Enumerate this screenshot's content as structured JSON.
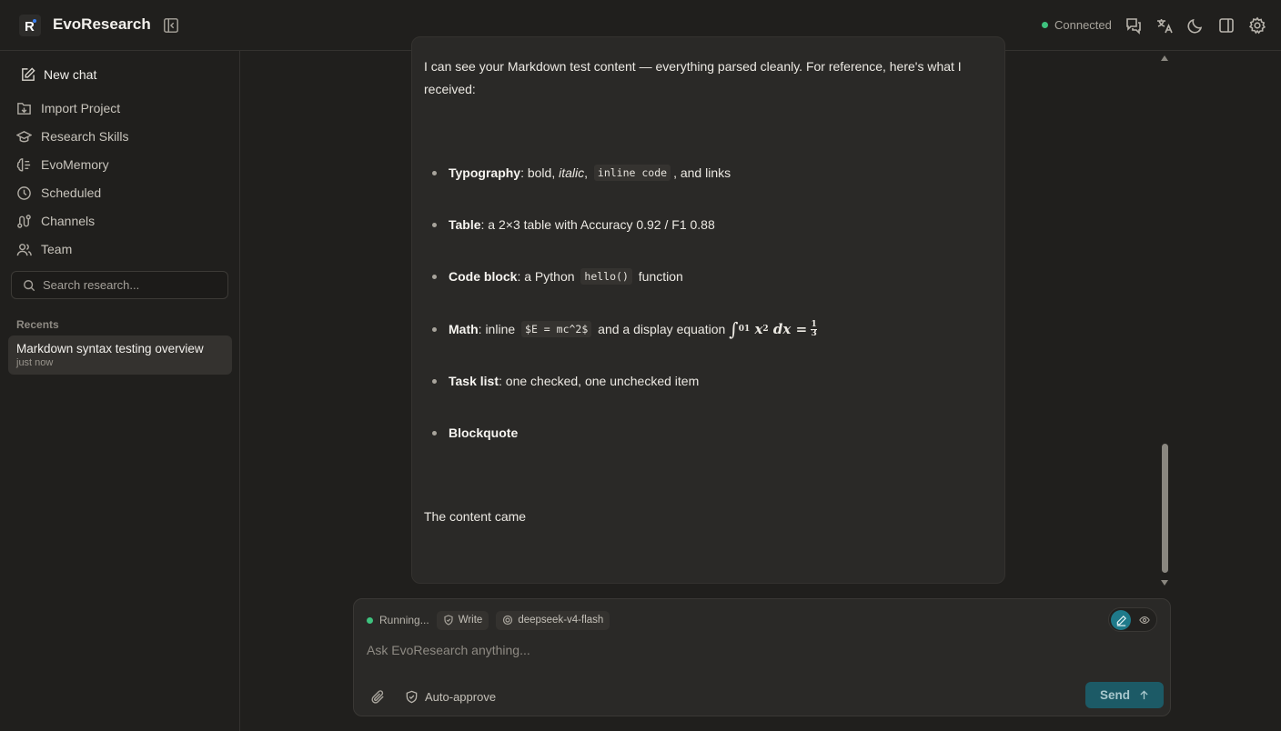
{
  "header": {
    "brand": "EvoResearch",
    "status": "Connected",
    "colors": {
      "accent": "#1f7a8a",
      "status_ok": "#3ec27e"
    }
  },
  "sidebar": {
    "new_chat": "New chat",
    "items": [
      {
        "label": "Import Project",
        "icon": "import-icon"
      },
      {
        "label": "Research Skills",
        "icon": "graduation-cap-icon"
      },
      {
        "label": "EvoMemory",
        "icon": "brain-icon"
      },
      {
        "label": "Scheduled",
        "icon": "clock-icon"
      },
      {
        "label": "Channels",
        "icon": "route-icon"
      },
      {
        "label": "Team",
        "icon": "users-icon"
      }
    ],
    "search_placeholder": "Search research...",
    "recents_label": "Recents",
    "recents": [
      {
        "title": "Markdown syntax testing overview",
        "time": "just now"
      }
    ]
  },
  "message": {
    "intro": "I can see your Markdown test content — everything parsed cleanly. For reference, here's what I received:",
    "bullets": {
      "typography": {
        "label": "Typography",
        "text_a": ": bold, ",
        "italic": "italic",
        "text_b": ", ",
        "code": "inline code",
        "text_c": ", and links"
      },
      "table": {
        "label": "Table",
        "text": ": a 2×3 table with Accuracy 0.92 / F1 0.88"
      },
      "code_block": {
        "label": "Code block",
        "text_a": ": a Python ",
        "code": "hello()",
        "text_b": " function"
      },
      "math": {
        "label": "Math",
        "text_a": ": inline ",
        "code": "$E = mc^2$",
        "text_b": " and a display equation",
        "int_lower": "0",
        "int_upper": "1",
        "frac_num": "1",
        "frac_den": "3"
      },
      "task_list": {
        "label": "Task list",
        "text": ": one checked, one unchecked item"
      },
      "blockquote": {
        "label": "Blockquote"
      }
    },
    "tail": "The content came"
  },
  "composer": {
    "running": "Running...",
    "mode_chip": "Write",
    "model_chip": "deepseek-v4-flash",
    "placeholder": "Ask EvoResearch anything...",
    "auto_approve": "Auto-approve",
    "send": "Send"
  }
}
